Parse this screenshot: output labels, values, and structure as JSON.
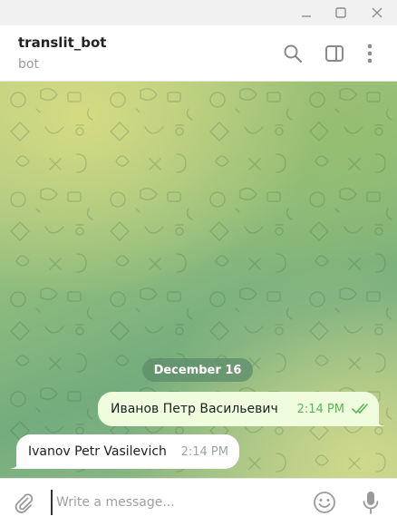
{
  "window": {
    "controls": [
      "minimize-icon",
      "maximize-icon",
      "close-icon"
    ]
  },
  "header": {
    "title": "translit_bot",
    "status": "bot",
    "icons": [
      "search-icon",
      "sidebar-toggle-icon",
      "more-vertical-icon"
    ]
  },
  "chat": {
    "date_separator": "December 16",
    "messages": [
      {
        "direction": "outgoing",
        "text": "Иванов Петр Васильевич",
        "time": "2:14 PM",
        "status": "read"
      },
      {
        "direction": "incoming",
        "text": "Ivanov Petr Vasilevich",
        "time": "2:14 PM"
      }
    ]
  },
  "composer": {
    "placeholder": "Write a message...",
    "value": "",
    "icons": [
      "paperclip-icon",
      "emoji-icon",
      "microphone-icon"
    ]
  },
  "colors": {
    "outgoing_bubble": "#effdde",
    "incoming_bubble": "#ffffff",
    "read_checks": "#5fb25a",
    "date_pill": "#5e8c69"
  }
}
